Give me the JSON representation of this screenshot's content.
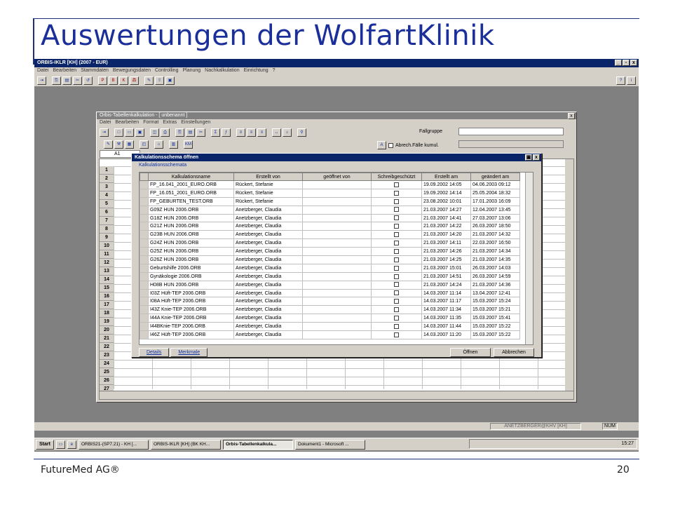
{
  "slide": {
    "title": "Auswertungen der WolfartKlinik",
    "footer_left": "FutureMed AG®",
    "footer_right": "20"
  },
  "app": {
    "title": "ORBIS-IKLR [KH] (2007 - EUR)",
    "menu": [
      "Datei",
      "Bearbeiten",
      "Stammdaten",
      "Bewegungsdaten",
      "Controlling",
      "Planung",
      "Nachkalkulation",
      "Einrichtung",
      "?"
    ]
  },
  "subwindow": {
    "title": "Orbis-Tabellenkalkulation - [ unbenannt ]",
    "menu": [
      "Datei",
      "Bearbeiten",
      "Format",
      "Extras",
      "Einstellungen"
    ],
    "fallgruppe_label": "Fallgruppe",
    "abrech_label": "Abrech.Fälle kumul.",
    "km_label": "KM",
    "cell_ref": "A1",
    "row_numbers": [
      "1",
      "2",
      "3",
      "4",
      "5",
      "6",
      "7",
      "8",
      "9",
      "10",
      "11",
      "12",
      "13",
      "14",
      "15",
      "16",
      "17",
      "18",
      "19",
      "20",
      "21",
      "22",
      "23",
      "24",
      "25",
      "26",
      "27"
    ]
  },
  "dialog": {
    "title": "Kalkulationsschema öffnen",
    "subtitle": "Kalkulationsschemata",
    "columns": [
      "Kalkulationsname",
      "Erstellt von",
      "geöffnet von",
      "Schreibgeschützt",
      "Erstellt am",
      "geändert am"
    ],
    "rows": [
      [
        "FP_16.041_2001_EURO.ORB",
        "Rückert, Stefanie",
        "",
        "",
        "19.09.2002 14:05",
        "04.06.2003 09:12"
      ],
      [
        "FP_16.051_2001_EURO.ORB",
        "Rückert, Stefanie",
        "",
        "",
        "19.09.2002 14:14",
        "25.05.2004 18:32"
      ],
      [
        "FP_GEBURTEN_TEST.ORB",
        "Rückert, Stefanie",
        "",
        "",
        "23.08.2002 10:01",
        "17.01.2003 16:09"
      ],
      [
        "G09Z HUN 2006.ORB",
        "Anetzberger, Claudia",
        "",
        "",
        "21.03.2007 14:27",
        "12.04.2007 13:45"
      ],
      [
        "G18Z HUN 2006.ORB",
        "Anetzberger, Claudia",
        "",
        "",
        "21.03.2007 14:41",
        "27.03.2007 13:06"
      ],
      [
        "G21Z HUN 2006.ORB",
        "Anetzberger, Claudia",
        "",
        "",
        "21.03.2007 14:22",
        "26.03.2007 18:50"
      ],
      [
        "G23B HUN 2006.ORB",
        "Anetzberger, Claudia",
        "",
        "",
        "21.03.2007 14:20",
        "21.03.2007 14:32"
      ],
      [
        "G24Z HUN 2006.ORB",
        "Anetzberger, Claudia",
        "",
        "",
        "21.03.2007 14:11",
        "22.03.2007 16:50"
      ],
      [
        "G25Z HUN 2006.ORB",
        "Anetzberger, Claudia",
        "",
        "",
        "21.03.2007 14:26",
        "21.03.2007 14:34"
      ],
      [
        "G26Z HUN 2006.ORB",
        "Anetzberger, Claudia",
        "",
        "",
        "21.03.2007 14:25",
        "21.03.2007 14:35"
      ],
      [
        "Geburtshilfe 2006.ORB",
        "Anetzberger, Claudia",
        "",
        "",
        "21.03.2007 15:01",
        "26.03.2007 14:03"
      ],
      [
        "Gynäkologie 2006.ORB",
        "Anetzberger, Claudia",
        "",
        "",
        "21.03.2007 14:51",
        "26.03.2007 14:59"
      ],
      [
        "H08B HUN 2006.ORB",
        "Anetzberger, Claudia",
        "",
        "",
        "21.03.2007 14:24",
        "21.03.2007 14:36"
      ],
      [
        "I03Z Hüft-TEP 2006.ORB",
        "Anetzberger, Claudia",
        "",
        "",
        "14.03.2007 11:14",
        "13.04.2007 12:41"
      ],
      [
        "I08A Hüft-TEP 2006.ORB",
        "Anetzberger, Claudia",
        "",
        "",
        "14.03.2007 11:17",
        "15.03.2007 15:24"
      ],
      [
        "I43Z Knie-TEP 2006.ORB",
        "Anetzberger, Claudia",
        "",
        "",
        "14.03.2007 11:34",
        "15.03.2007 15:21"
      ],
      [
        "I44A Knie-TEP 2006.ORB",
        "Anetzberger, Claudia",
        "",
        "",
        "14.03.2007 11:35",
        "15.03.2007 15:41"
      ],
      [
        "I44BKnie-TEP 2006.ORB",
        "Anetzberger, Claudia",
        "",
        "",
        "14.03.2007 11:44",
        "15.03.2007 15:22"
      ],
      [
        "I46Z Hüft-TEP 2006.ORB",
        "Anetzberger, Claudia",
        "",
        "",
        "14.03.2007 11:20",
        "15.03.2007 15:22"
      ]
    ],
    "btn_details": "Details",
    "btn_merkmale": "Merkmale",
    "btn_open": "Öffnen",
    "btn_cancel": "Abbrechen"
  },
  "status": {
    "user": "ANETZBERGER@KHV [KH]",
    "num": "NUM"
  },
  "taskbar": {
    "start": "Start",
    "tasks": [
      "ORBIS21-(SP7.21) - KH [...",
      "ORBIS-IKLR [KH] (BK KH...",
      "Orbis-Tabellenkalkula...",
      "Dokument1 - Microsoft ..."
    ],
    "clock": "15:27"
  }
}
